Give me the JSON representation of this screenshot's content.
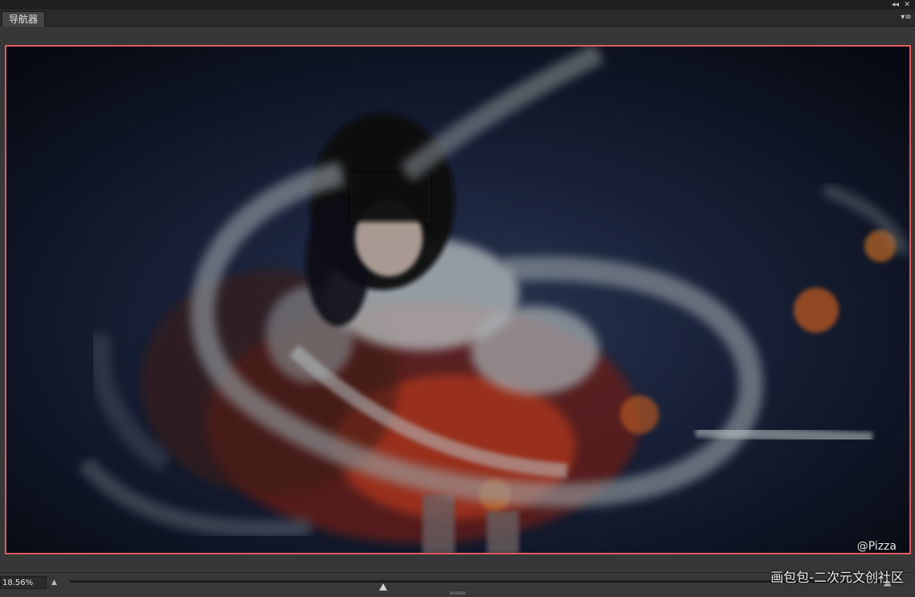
{
  "panel": {
    "tab_label": "导航器",
    "collapse_icon": "double-left-arrow-icon",
    "collapse_glyph": "◂◂",
    "close_glyph": "✕",
    "menu_glyph": "▾≡"
  },
  "image": {
    "description_icon": "artwork-preview",
    "watermark": "@Pizza"
  },
  "zoom": {
    "value": "18.56%",
    "slider_level": 0.385
  },
  "overlay": {
    "caption": "画包包-二次元文创社区"
  },
  "colors": {
    "view_box": "#e05a5f",
    "panel_bg": "#383838"
  }
}
